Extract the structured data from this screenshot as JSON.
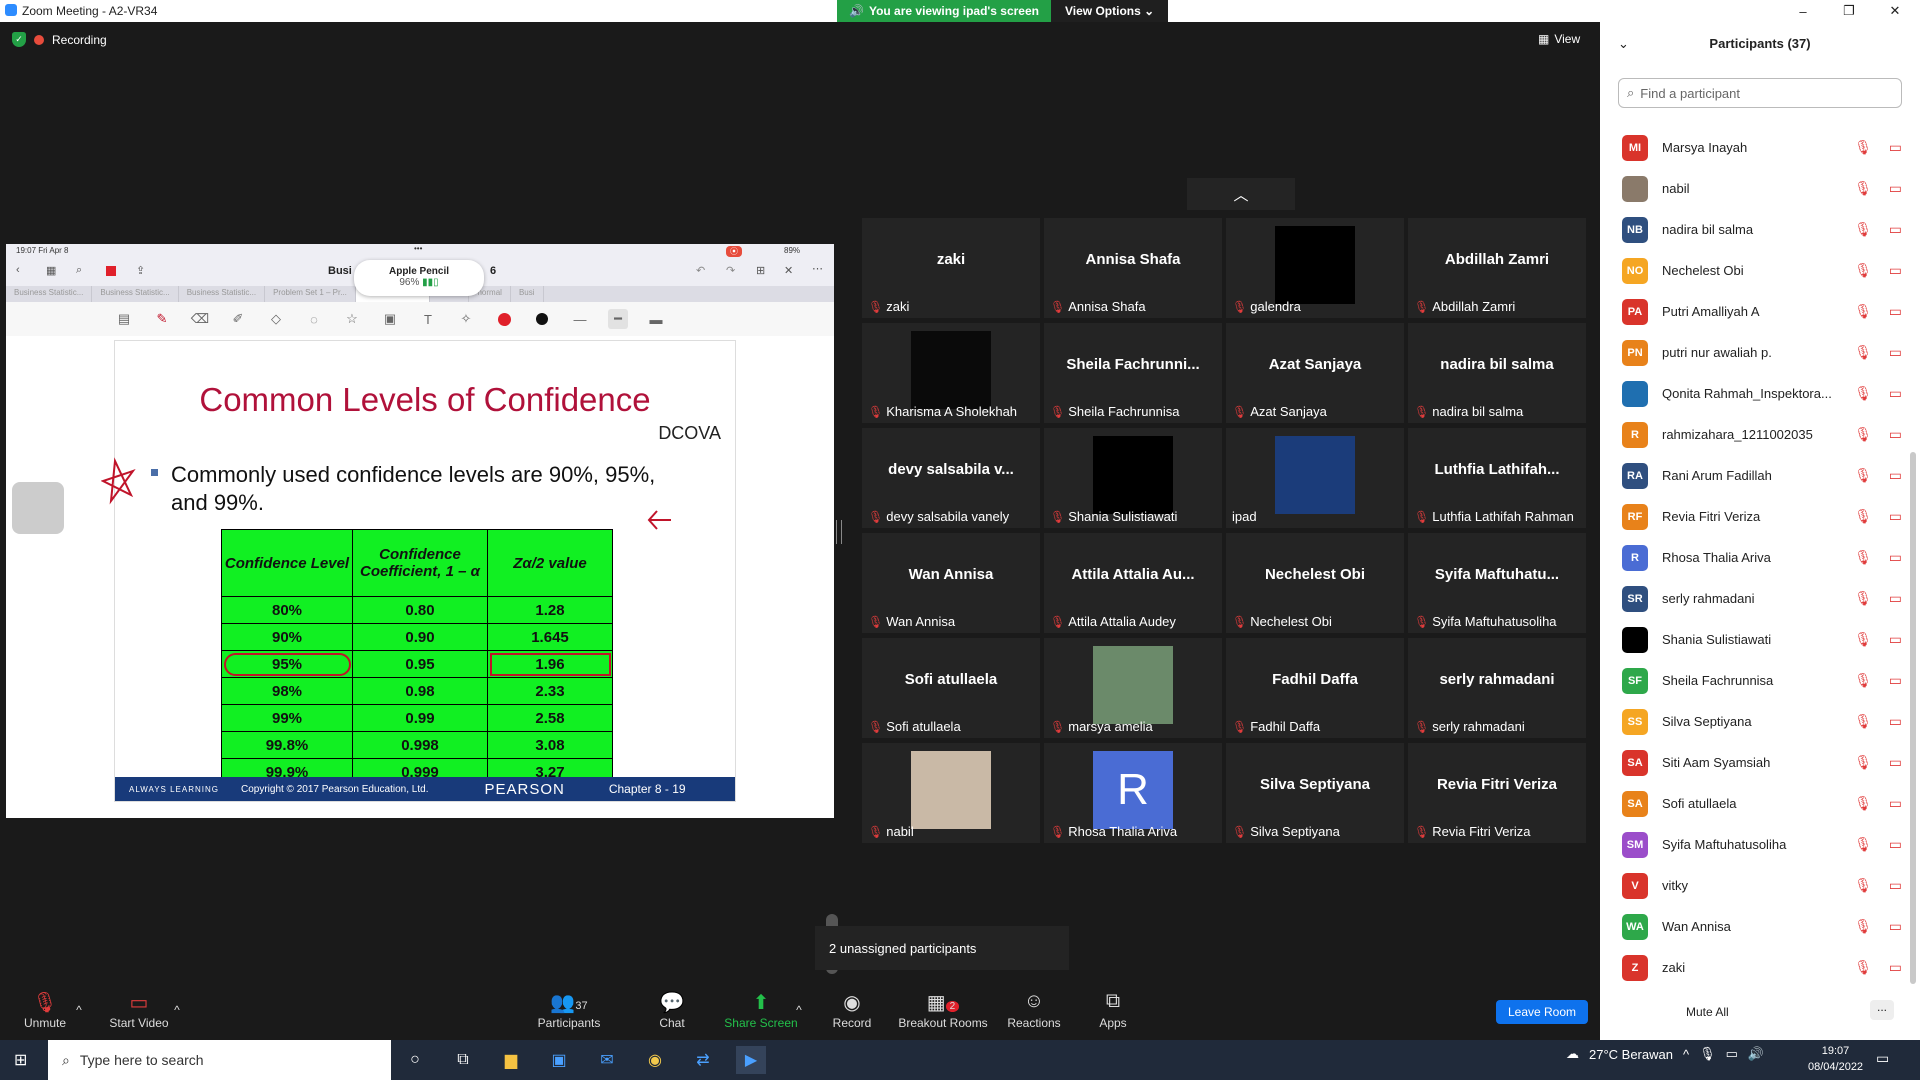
{
  "window": {
    "title": "Zoom Meeting - A2-VR34",
    "minimize": "–",
    "maximize": "❐",
    "close": "✕"
  },
  "banner": {
    "viewing": "You are viewing ipad's screen",
    "view_options": "View Options"
  },
  "meeting": {
    "recording": "Recording",
    "view_label": "View"
  },
  "ipad": {
    "status_time": "19:07  Fri Apr 8",
    "status_battery": "89%",
    "doc_title_left": "Busi",
    "doc_title_right": "6",
    "pencil_title": "Apple Pencil",
    "pencil_level": "96%",
    "tabs": [
      "Business Statistic...",
      "Business Statistic...",
      "Business Statistic...",
      "Problem Set 1 – Pr...",
      "Business Stati...",
      "t-table",
      "normal",
      "Busi"
    ],
    "active_tab_index": 4
  },
  "slide": {
    "title": "Common Levels of Confidence",
    "dcova": "DCOVA",
    "bullet": "Commonly used confidence levels are 90%, 95%, and 99%.",
    "table": {
      "headers": [
        "Confidence Level",
        "Confidence Coefficient, 1 – α",
        "Zα/2 value"
      ],
      "rows": [
        [
          "80%",
          "0.80",
          "1.28"
        ],
        [
          "90%",
          "0.90",
          "1.645"
        ],
        [
          "95%",
          "0.95",
          "1.96"
        ],
        [
          "98%",
          "0.98",
          "2.33"
        ],
        [
          "99%",
          "0.99",
          "2.58"
        ],
        [
          "99.8%",
          "0.998",
          "3.08"
        ],
        [
          "99.9%",
          "0.999",
          "3.27"
        ]
      ]
    },
    "footer": {
      "left": "ALWAYS LEARNING",
      "copyright": "Copyright © 2017 Pearson Education, Ltd.",
      "brand": "PEARSON",
      "chapter": "Chapter 8 - 19"
    }
  },
  "gallery": [
    {
      "name": "zaki",
      "label": "zaki",
      "muted": true
    },
    {
      "name": "Annisa Shafa",
      "label": "Annisa Shafa",
      "muted": true
    },
    {
      "name": "",
      "label": "galendra",
      "muted": true,
      "image": "black-video"
    },
    {
      "name": "Abdillah Zamri",
      "label": "Abdillah Zamri",
      "muted": true
    },
    {
      "name": "",
      "label": "Kharisma A Sholekhah",
      "muted": true,
      "image": "dark-photo"
    },
    {
      "name": "Sheila  Fachrunni...",
      "label": "Sheila Fachrunnisa",
      "muted": true
    },
    {
      "name": "Azat Sanjaya",
      "label": "Azat Sanjaya",
      "muted": true
    },
    {
      "name": "nadira bil salma",
      "label": "nadira bil salma",
      "muted": true
    },
    {
      "name": "devy  salsabila  v...",
      "label": "devy salsabila vanely",
      "muted": true
    },
    {
      "name": "",
      "label": "Shania Sulistiawati",
      "muted": true,
      "image": "black-video"
    },
    {
      "name": "",
      "label": "ipad",
      "muted": false,
      "image": "logo-photo"
    },
    {
      "name": "Luthfia  Lathifah...",
      "label": "Luthfia Lathifah Rahman",
      "muted": true
    },
    {
      "name": "Wan Annisa",
      "label": "Wan Annisa",
      "muted": true
    },
    {
      "name": "Attila Attalia Au...",
      "label": "Attila Attalia Audey",
      "muted": true
    },
    {
      "name": "Nechelest Obi",
      "label": "Nechelest Obi",
      "muted": true
    },
    {
      "name": "Syifa  Maftuhatu...",
      "label": "Syifa Maftuhatusoliha",
      "muted": true
    },
    {
      "name": "Sofi atullaela",
      "label": "Sofi atullaela",
      "muted": true
    },
    {
      "name": "",
      "label": "marsya amelia",
      "muted": true,
      "image": "outdoor-photo"
    },
    {
      "name": "Fadhil Daffa",
      "label": "Fadhil Daffa",
      "muted": true
    },
    {
      "name": "serly rahmadani",
      "label": "serly rahmadani",
      "muted": true
    },
    {
      "name": "",
      "label": "nabil",
      "muted": true,
      "image": "person-photo"
    },
    {
      "name": "",
      "label": "Rhosa Thalia Ariva",
      "muted": true,
      "image": "letter-R"
    },
    {
      "name": "Silva Septiyana",
      "label": "Silva Septiyana",
      "muted": true
    },
    {
      "name": "Revia Fitri Veriza",
      "label": "Revia Fitri Veriza",
      "muted": true
    }
  ],
  "unassigned": "2 unassigned participants",
  "toolbar": {
    "unmute": "Unmute",
    "start_video": "Start Video",
    "participants": "Participants",
    "participants_count": "37",
    "chat": "Chat",
    "share_screen": "Share Screen",
    "record": "Record",
    "breakout_rooms": "Breakout Rooms",
    "breakout_badge": "2",
    "reactions": "Reactions",
    "apps": "Apps",
    "leave_room": "Leave Room"
  },
  "participants_panel": {
    "title": "Participants (37)",
    "search_placeholder": "Find a participant",
    "mute_all": "Mute All",
    "more": "...",
    "list": [
      {
        "initials": "MI",
        "name": "Marsya Inayah",
        "color": "#d9342b"
      },
      {
        "initials": "",
        "name": "nabil",
        "color": "#8a7a6a"
      },
      {
        "initials": "NB",
        "name": "nadira bil salma",
        "color": "#2f4f7f"
      },
      {
        "initials": "NO",
        "name": "Nechelest Obi",
        "color": "#f5a623"
      },
      {
        "initials": "PA",
        "name": "Putri Amalliyah A",
        "color": "#d9342b"
      },
      {
        "initials": "PN",
        "name": "putri nur awaliah p.",
        "color": "#e8821a"
      },
      {
        "initials": "",
        "name": "Qonita Rahmah_Inspektora...",
        "color": "#1f6fb0"
      },
      {
        "initials": "R",
        "name": "rahmizahara_1211002035",
        "color": "#e8821a"
      },
      {
        "initials": "RA",
        "name": "Rani Arum Fadillah",
        "color": "#2f4f7f"
      },
      {
        "initials": "RF",
        "name": "Revia Fitri Veriza",
        "color": "#e8821a"
      },
      {
        "initials": "R",
        "name": "Rhosa Thalia Ariva",
        "color": "#4a6cd4"
      },
      {
        "initials": "SR",
        "name": "serly rahmadani",
        "color": "#2f4f7f"
      },
      {
        "initials": "",
        "name": "Shania Sulistiawati",
        "color": "#000000"
      },
      {
        "initials": "SF",
        "name": "Sheila Fachrunnisa",
        "color": "#2ea84a"
      },
      {
        "initials": "SS",
        "name": "Silva Septiyana",
        "color": "#f5a623"
      },
      {
        "initials": "SA",
        "name": "Siti Aam Syamsiah",
        "color": "#d9342b"
      },
      {
        "initials": "SA",
        "name": "Sofi atullaela",
        "color": "#e8821a"
      },
      {
        "initials": "SM",
        "name": "Syifa Maftuhatusoliha",
        "color": "#9b4dca"
      },
      {
        "initials": "V",
        "name": "vitky",
        "color": "#d9342b"
      },
      {
        "initials": "WA",
        "name": "Wan Annisa",
        "color": "#2ea84a"
      },
      {
        "initials": "Z",
        "name": "zaki",
        "color": "#d9342b"
      }
    ]
  },
  "taskbar": {
    "search_placeholder": "Type here to search",
    "weather": "27°C  Berawan",
    "time": "19:07",
    "date": "08/04/2022"
  }
}
